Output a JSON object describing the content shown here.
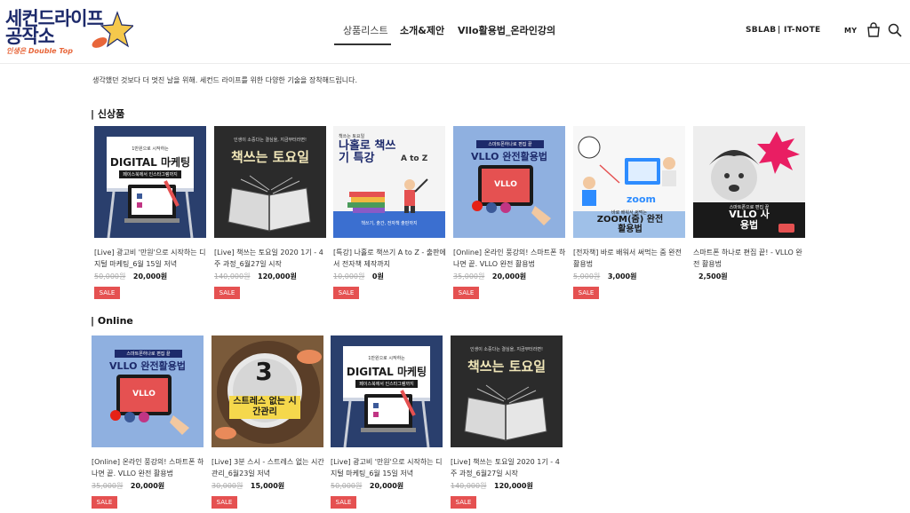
{
  "logo": {
    "line1": "세컨드라이프",
    "line2": "공작소",
    "sub": "인생은 Double Top"
  },
  "nav": {
    "items": [
      {
        "label": "상품리스트",
        "active": true
      },
      {
        "label": "소개&제안",
        "active": false
      },
      {
        "label": "Vllo활용법_온라인강의",
        "active": false
      }
    ]
  },
  "header_right": {
    "links": [
      "SBLAB",
      "| IT-NOTE",
      "MY"
    ],
    "icons": [
      "bag-icon",
      "search-icon"
    ]
  },
  "tagline": "생각했던 것보다 더 멋진 날을 위해. 세컨드 라이프를 위한 다양한 기술을 장착해드립니다.",
  "sections": [
    {
      "title": "| 신상품",
      "products": [
        {
          "title": "[Live] 광고비 '만원'으로 시작하는 디지털 마케팅_6월 15일 저녁",
          "old_price": "50,000원",
          "price": "20,000원",
          "badge": "SALE",
          "thumb": {
            "top": "1만원으로 시작하는",
            "main": "DIGITAL 마케팅",
            "sub": "페이스북에서 인스타그램까지"
          }
        },
        {
          "title": "[Live] 책쓰는 토요일 2020 1기 - 4주 과정_6월27일 시작",
          "old_price": "140,000원",
          "price": "120,000원",
          "badge": "SALE",
          "thumb": {
            "top": "인생이 소중다는 결심을, 지금부터라면!",
            "main": "책쓰는 토요일"
          }
        },
        {
          "title": "[특강] 나홀로 책쓰기 A to Z - 출판에서 전자책 제작까지",
          "old_price": "10,000원",
          "price": "0원",
          "badge": "SALE",
          "thumb": {
            "top": "책쓰는 토요일",
            "main": "나홀로 책쓰기 특강",
            "sub": "A to Z",
            "bottom": "책쓰기, 출간, 전자책 출판까지"
          }
        },
        {
          "title": "[Online] 온라인 풍강의! 스마트폰 하나면 끝. VLLO 완전 활용법",
          "old_price": "35,000원",
          "price": "20,000원",
          "badge": "SALE",
          "thumb": {
            "top": "스마트폰하나로 편집 끝",
            "main": "VLLO 완전활용법",
            "screen": "VLLO"
          }
        },
        {
          "title": "[전자책] 바로 배워서 써먹는 줌 완전 활용법",
          "old_price": "5,000원",
          "price": "3,000원",
          "badge": "SALE",
          "thumb": {
            "brand": "zoom",
            "top": "바로 배워서 써먹는",
            "main": "ZOOM(줌) 완전활용법"
          }
        },
        {
          "title": "스마트폰 하나로 편집 끝! - VLLO 완전 활용법",
          "old_price": "",
          "price": "2,500원",
          "badge": "",
          "thumb": {
            "top": "스마트폰으로 편집 끝",
            "main": "VLLO 사용법"
          }
        }
      ]
    },
    {
      "title": "| Online",
      "products": [
        {
          "title": "[Online] 온라인 풍강의! 스마트폰 하나면 끝. VLLO 완전 활용법",
          "old_price": "35,000원",
          "price": "20,000원",
          "badge": "SALE",
          "thumb": {
            "top": "스마트폰하나로 편집 끝",
            "main": "VLLO 완전활용법",
            "screen": "VLLO"
          }
        },
        {
          "title": "[Live] 3분 스시 - 스트레스 없는 시간관리_6월23일 저녁",
          "old_price": "30,000원",
          "price": "15,000원",
          "badge": "SALE",
          "thumb": {
            "num": "3",
            "main": "스트레스 없는 시간관리"
          }
        },
        {
          "title": "[Live] 광고비 '만원'으로 시작하는 디지털 마케팅_6월 15일 저녁",
          "old_price": "50,000원",
          "price": "20,000원",
          "badge": "SALE",
          "thumb": {
            "top": "1만원으로 시작하는",
            "main": "DIGITAL 마케팅",
            "sub": "페이스북에서 인스타그램까지"
          }
        },
        {
          "title": "[Live] 책쓰는 토요일 2020 1기 - 4주 과정_6월27일 시작",
          "old_price": "140,000원",
          "price": "120,000원",
          "badge": "SALE",
          "thumb": {
            "top": "인생이 소중다는 결심을, 지금부터라면!",
            "main": "책쓰는 토요일"
          }
        }
      ]
    }
  ]
}
